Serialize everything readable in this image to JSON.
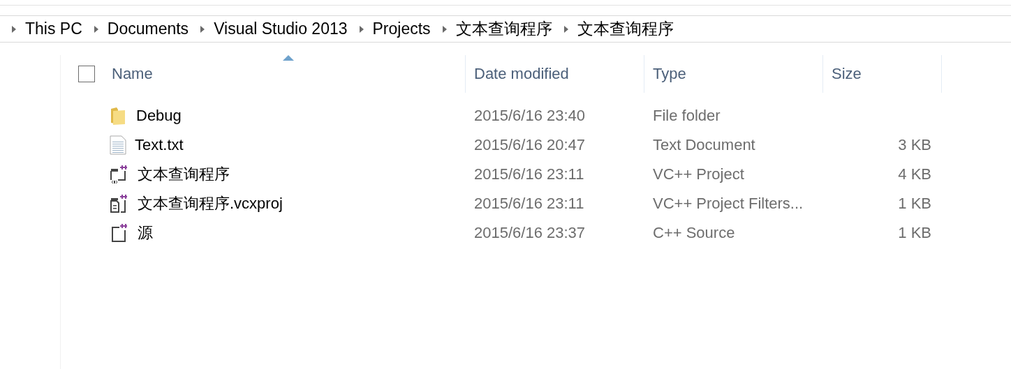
{
  "breadcrumb": [
    "This PC",
    "Documents",
    "Visual Studio 2013",
    "Projects",
    "文本查询程序",
    "文本查询程序"
  ],
  "header": {
    "checked": false,
    "columns": [
      {
        "label": "Name",
        "sorted": true
      },
      {
        "label": "Date modified",
        "sorted": false
      },
      {
        "label": "Type",
        "sorted": false
      },
      {
        "label": "Size",
        "sorted": false
      }
    ]
  },
  "rows": [
    {
      "kind": "folder",
      "name": "Debug",
      "date": "2015/6/16 23:40",
      "type": "File folder"
    },
    {
      "kind": "text",
      "name": "Text.txt",
      "date": "2015/6/16 20:47",
      "type": "Text Document",
      "size": "3 KB"
    },
    {
      "kind": "vcproj",
      "name": "文本查询程序",
      "date": "2015/6/16 23:11",
      "type": "VC++ Project",
      "size": "4 KB"
    },
    {
      "kind": "filters",
      "name": "文本查询程序.vcxproj",
      "date": "2015/6/16 23:11",
      "type": "VC++ Project Filters...",
      "size": "1 KB"
    },
    {
      "kind": "cpp",
      "name": "源",
      "date": "2015/6/16 23:37",
      "type": "C++ Source",
      "size": "1 KB"
    }
  ]
}
